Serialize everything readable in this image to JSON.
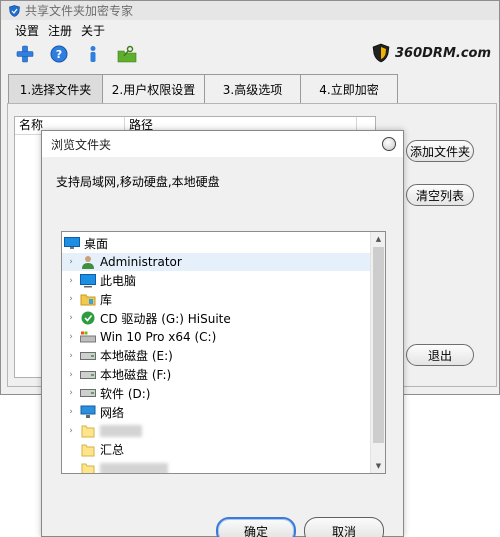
{
  "window": {
    "title": "共享文件夹加密专家",
    "brand": "360DRM.com"
  },
  "menu": {
    "items": [
      "设置",
      "注册",
      "关于"
    ]
  },
  "toolbar": {
    "icons": [
      "add-icon",
      "help-icon",
      "info-icon",
      "key-folder-icon"
    ]
  },
  "tabs": [
    {
      "label": "1.选择文件夹",
      "active": true
    },
    {
      "label": "2.用户权限设置",
      "active": false
    },
    {
      "label": "3.高级选项",
      "active": false
    },
    {
      "label": "4.立即加密",
      "active": false
    }
  ],
  "file_list": {
    "columns": [
      "名称",
      "路径"
    ]
  },
  "side_buttons": {
    "add_folder": "添加文件夹",
    "clear_list": "清空列表",
    "exit": "退出"
  },
  "dialog": {
    "title": "浏览文件夹",
    "description": "支持局域网,移动硬盘,本地硬盘",
    "tree": [
      {
        "label": "桌面",
        "icon": "desktop-icon",
        "expandable": false,
        "level": 0
      },
      {
        "label": "Administrator",
        "icon": "user-icon",
        "expandable": true,
        "level": 1,
        "highlighted": true
      },
      {
        "label": "此电脑",
        "icon": "computer-icon",
        "expandable": true,
        "level": 1
      },
      {
        "label": "库",
        "icon": "library-icon",
        "expandable": true,
        "level": 1
      },
      {
        "label": "CD 驱动器 (G:) HiSuite",
        "icon": "cd-drive-icon",
        "expandable": true,
        "level": 1
      },
      {
        "label": "Win 10 Pro x64 (C:)",
        "icon": "system-drive-icon",
        "expandable": true,
        "level": 1
      },
      {
        "label": "本地磁盘 (E:)",
        "icon": "disk-icon",
        "expandable": true,
        "level": 1
      },
      {
        "label": "本地磁盘 (F:)",
        "icon": "disk-icon",
        "expandable": true,
        "level": 1
      },
      {
        "label": "软件 (D:)",
        "icon": "disk-icon",
        "expandable": true,
        "level": 1
      },
      {
        "label": "网络",
        "icon": "network-icon",
        "expandable": true,
        "level": 1
      },
      {
        "label": "",
        "icon": "folder-icon",
        "expandable": true,
        "level": 1,
        "blurred": true
      },
      {
        "label": "汇总",
        "icon": "folder-icon",
        "expandable": false,
        "level": 1
      },
      {
        "label": "",
        "icon": "folder-icon",
        "expandable": false,
        "level": 1,
        "blurred": true
      }
    ],
    "ok": "确定",
    "cancel": "取消"
  },
  "colors": {
    "accent": "#3a7bd5",
    "highlight": "#e5f0fb",
    "window_bg": "#f0f0f0"
  }
}
